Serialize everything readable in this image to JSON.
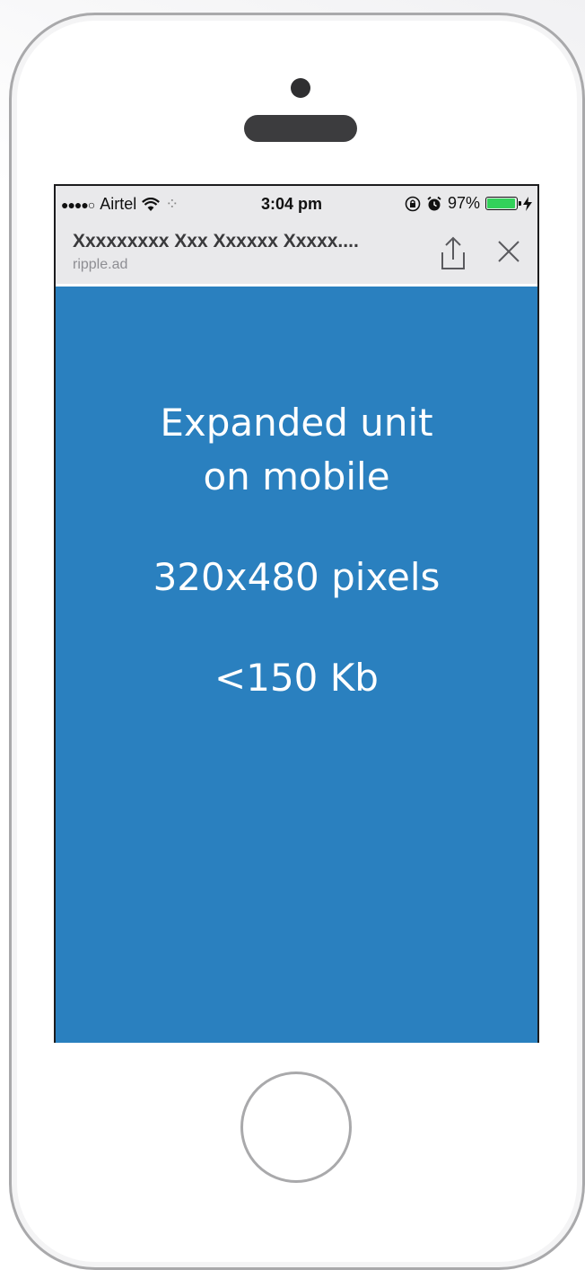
{
  "status_bar": {
    "signal": "●●●●○",
    "carrier": "Airtel",
    "time": "3:04 pm",
    "battery_percent": "97%",
    "battery_level": 0.97,
    "battery_color": "#32d15a"
  },
  "browser": {
    "page_title": "Xxxxxxxxx Xxx Xxxxxx Xxxxx....",
    "url": "ripple.ad",
    "icons": {
      "share": "share-icon",
      "close": "close-icon"
    }
  },
  "ad": {
    "background_color": "#2a80bf",
    "headline_line1": "Expanded unit",
    "headline_line2": "on mobile",
    "size": "320x480 pixels",
    "weight": "<150 Kb"
  }
}
